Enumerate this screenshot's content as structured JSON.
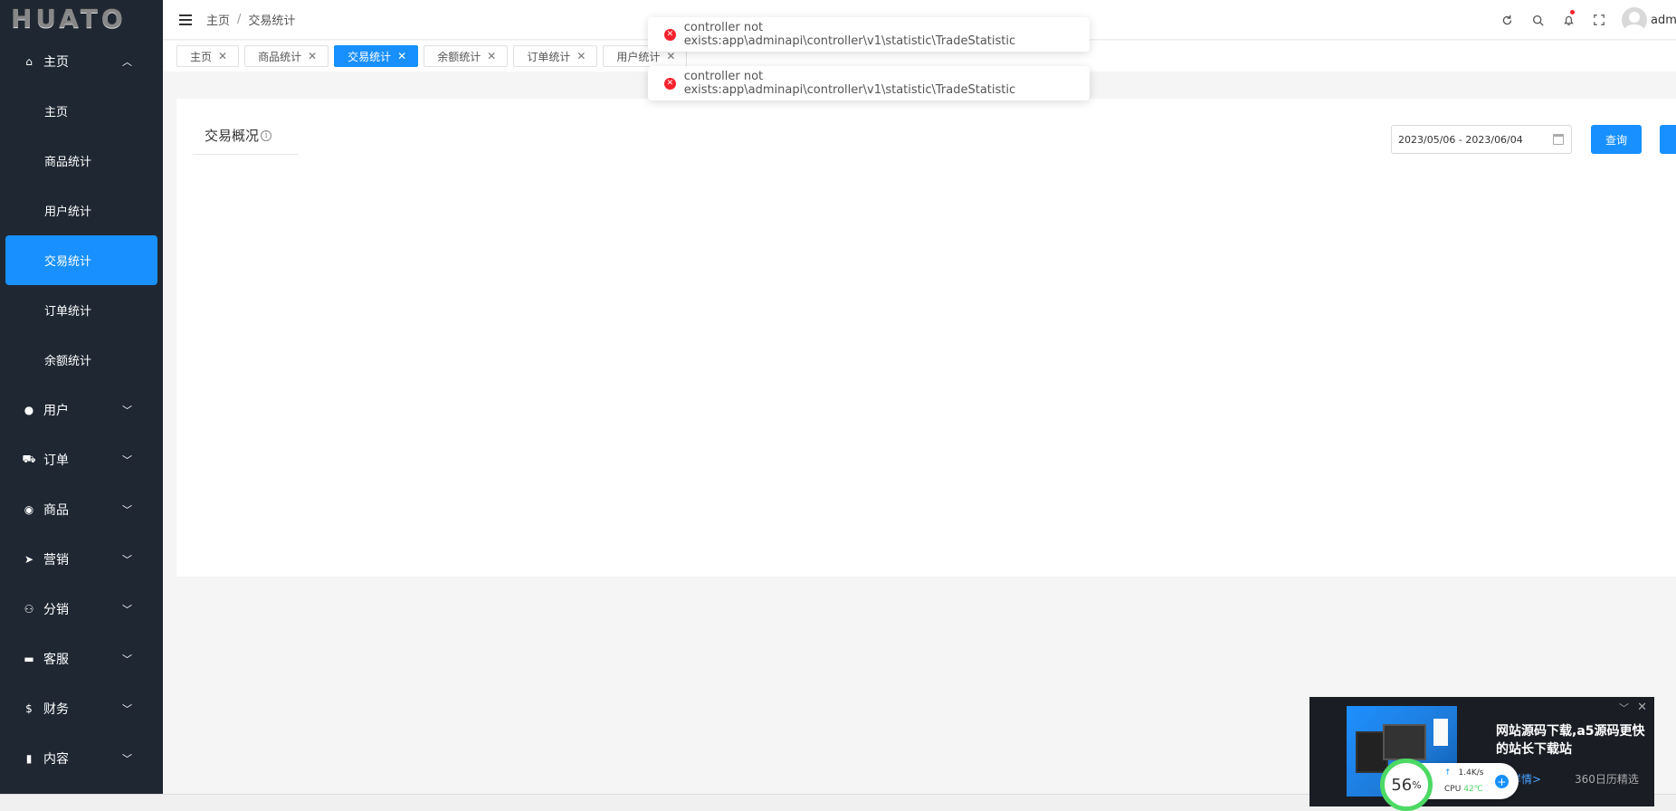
{
  "app": {
    "logo": "HUATO"
  },
  "sidebar": {
    "groups": [
      {
        "label": "主页",
        "icon": "home-icon",
        "glyph": "⌂",
        "expanded": true
      },
      {
        "label": "用户",
        "icon": "user-icon",
        "glyph": "●"
      },
      {
        "label": "订单",
        "icon": "cart-icon",
        "glyph": "⛟"
      },
      {
        "label": "商品",
        "icon": "basket-icon",
        "glyph": "◉"
      },
      {
        "label": "营销",
        "icon": "send-icon",
        "glyph": "➤"
      },
      {
        "label": "分销",
        "icon": "distribution-icon",
        "glyph": "⚇"
      },
      {
        "label": "客服",
        "icon": "chat-icon",
        "glyph": "▬"
      },
      {
        "label": "财务",
        "icon": "dollar-icon",
        "glyph": "$"
      },
      {
        "label": "内容",
        "icon": "book-icon",
        "glyph": "▮"
      }
    ],
    "submenu": [
      {
        "label": "主页"
      },
      {
        "label": "商品统计"
      },
      {
        "label": "用户统计"
      },
      {
        "label": "交易统计",
        "active": true
      },
      {
        "label": "订单统计"
      },
      {
        "label": "余额统计"
      }
    ]
  },
  "header": {
    "breadcrumb": [
      "主页",
      "交易统计"
    ],
    "breadcrumb_sep": "/",
    "user_name": "admin",
    "icons": [
      "refresh-icon",
      "search-icon",
      "bell-icon",
      "fullscreen-icon"
    ]
  },
  "tabs": [
    {
      "label": "主页"
    },
    {
      "label": "商品统计"
    },
    {
      "label": "交易统计",
      "active": true
    },
    {
      "label": "余额统计"
    },
    {
      "label": "订单统计"
    },
    {
      "label": "用户统计"
    }
  ],
  "main": {
    "title": "交易概况",
    "date_range": "2023/05/06 - 2023/06/04",
    "query_button": "查询"
  },
  "toasts": [
    {
      "message": "controller not exists:app\\adminapi\\controller\\v1\\statistic\\TradeStatistic"
    },
    {
      "message": "controller not exists:app\\adminapi\\controller\\v1\\statistic\\TradeStatistic"
    }
  ],
  "popup": {
    "headline": "网站源码下载,a5源码更快的站长下载站",
    "detail_link": "详情>",
    "source": "360日历精选"
  },
  "cpu_widget": {
    "percent": "56",
    "percent_unit": "%",
    "speed": "1.4K/s",
    "label": "CPU",
    "temp": "42℃"
  },
  "colors": {
    "sidebar_bg": "#1f2733",
    "accent": "#1890ff",
    "error": "#f5222d",
    "cpu_ring": "#4cd964"
  }
}
